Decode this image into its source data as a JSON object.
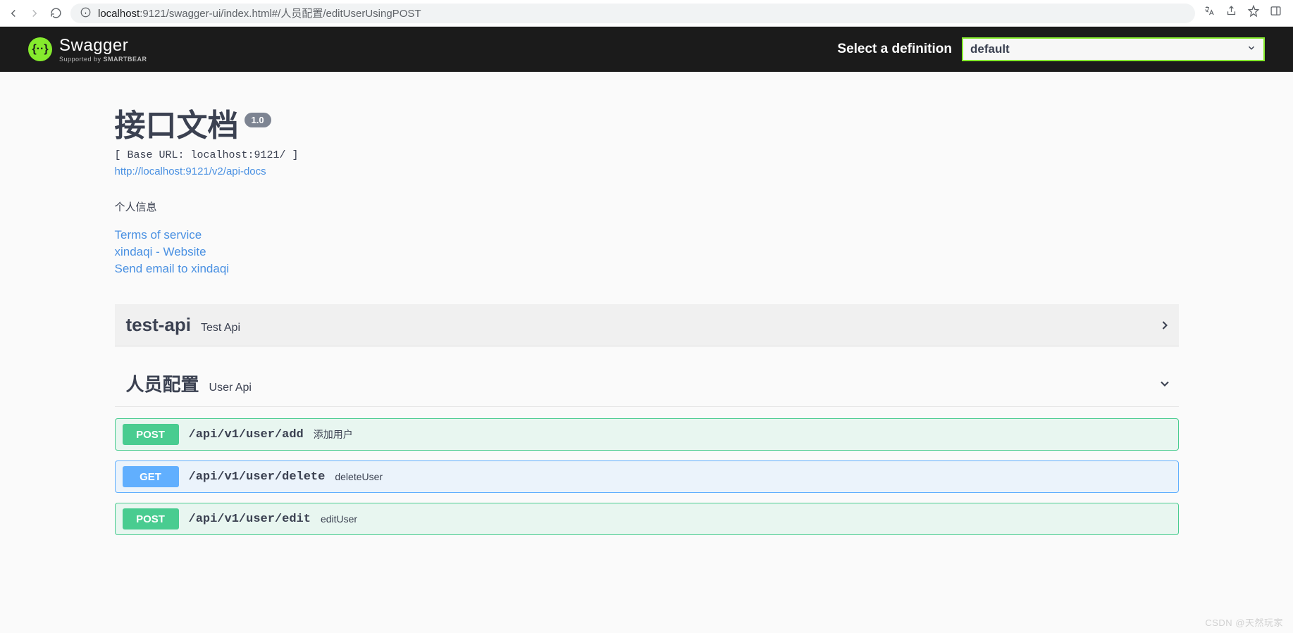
{
  "browser": {
    "url_host": "localhost",
    "url_port_path": ":9121/swagger-ui/index.html#/人员配置/editUserUsingPOST"
  },
  "topbar": {
    "brand": "Swagger",
    "supported_prefix": "Supported by ",
    "supported_name": "SMARTBEAR",
    "def_label": "Select a definition",
    "def_selected": "default"
  },
  "info": {
    "title": "接口文档",
    "version": "1.0",
    "base_url": "[ Base URL: localhost:9121/ ]",
    "docs_link": "http://localhost:9121/v2/api-docs",
    "description": "个人信息",
    "tos": "Terms of service",
    "contact_site": "xindaqi - Website",
    "contact_email": "Send email to xindaqi"
  },
  "sections": [
    {
      "tag": "test-api",
      "desc": "Test Api",
      "expanded": false
    },
    {
      "tag": "人员配置",
      "desc": "User Api",
      "expanded": true
    }
  ],
  "ops": [
    {
      "method": "POST",
      "path": "/api/v1/user/add",
      "summary": "添加用户"
    },
    {
      "method": "GET",
      "path": "/api/v1/user/delete",
      "summary": "deleteUser"
    },
    {
      "method": "POST",
      "path": "/api/v1/user/edit",
      "summary": "editUser"
    }
  ],
  "watermark": "CSDN @天然玩家"
}
